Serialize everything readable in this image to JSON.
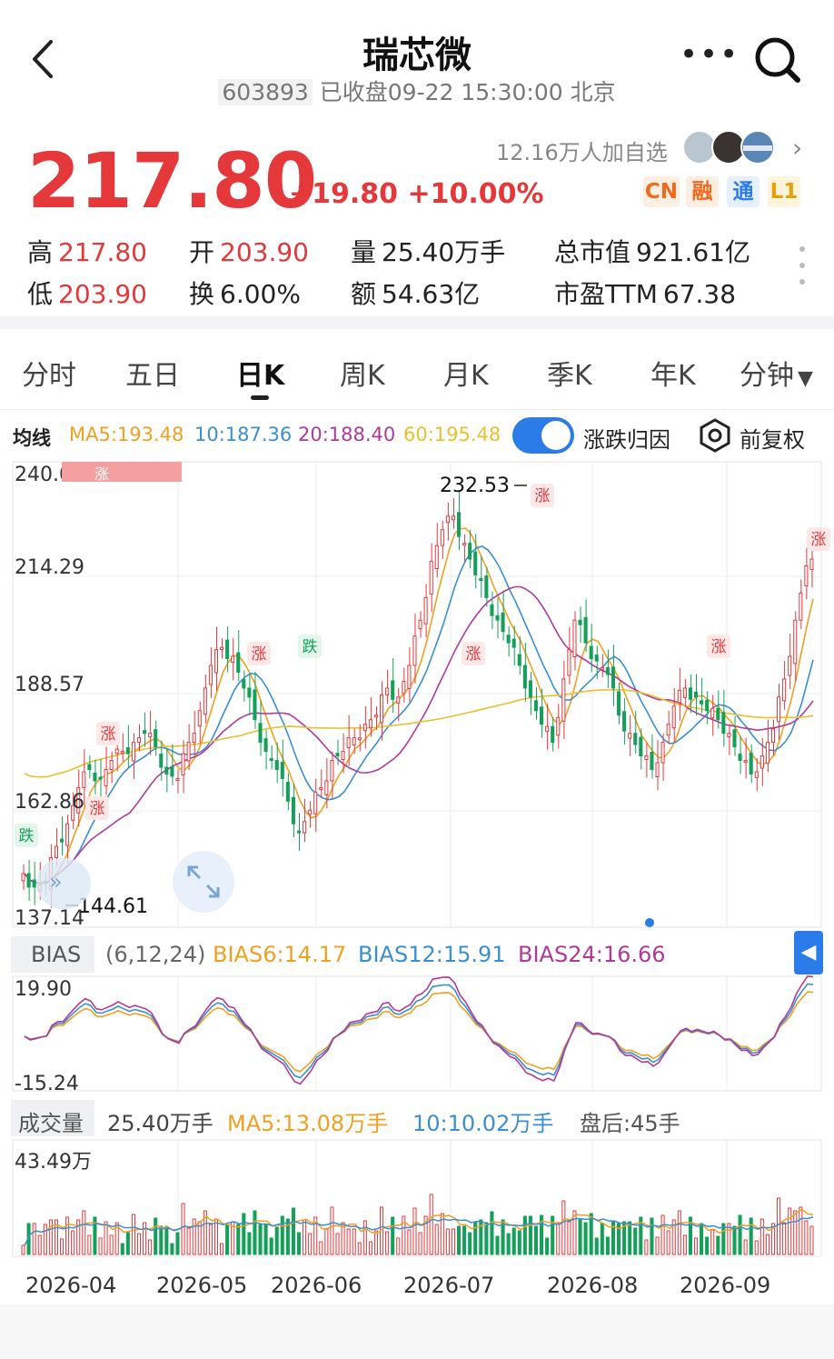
{
  "header": {
    "title": "瑞芯微",
    "code": "603893",
    "status": "已收盘09-22 15:30:00 北京"
  },
  "quote": {
    "price": "217.80",
    "change": "+19.80 +10.00%",
    "watchers": "12.16万人加自选",
    "badges": [
      "CN",
      "融",
      "通",
      "L1"
    ],
    "stats": {
      "high_label": "高",
      "high": "217.80",
      "open_label": "开",
      "open": "203.90",
      "volume_label": "量",
      "volume": "25.40万手",
      "mktcap_label": "总市值",
      "mktcap": "921.61亿",
      "low_label": "低",
      "low": "203.90",
      "turnover_label": "换",
      "turnover": "6.00%",
      "amount_label": "额",
      "amount": "54.63亿",
      "pe_label": "市盈TTM",
      "pe": "67.38"
    }
  },
  "tabs": [
    "分时",
    "五日",
    "日K",
    "周K",
    "月K",
    "季K",
    "年K",
    "分钟"
  ],
  "active_tab": "日K",
  "ma_bar": {
    "label": "均线",
    "ma5": "MA5:193.48",
    "ma10": "10:187.36",
    "ma20": "20:188.40",
    "ma60": "60:195.48",
    "attribution": "涨跌归因",
    "adjust": "前复权",
    "toggle_on": true
  },
  "colors": {
    "up": "#e5383b",
    "down": "#15a05a",
    "ma5": "#f0a020",
    "ma10": "#3a8fd0",
    "ma20": "#b03a9a",
    "ma60": "#e8c030",
    "accent": "#2b7ce9"
  },
  "bias": {
    "label": "BIAS",
    "params": "(6,12,24)",
    "b6": "BIAS6:14.17",
    "b12": "BIAS12:15.91",
    "b24": "BIAS24:16.66",
    "axis_top": "19.90",
    "axis_bottom": "-15.24"
  },
  "volume": {
    "label": "成交量",
    "value": "25.40万手",
    "ma5": "MA5:13.08万手",
    "ma10": "10:10.02万手",
    "after_hours": "盘后:45手",
    "axis_top": "43.49万"
  },
  "chart_data": {
    "type": "candlestick",
    "y_ticks": [
      "240.01",
      "214.29",
      "188.57",
      "162.86",
      "137.14"
    ],
    "ylim": [
      137.14,
      240.01
    ],
    "x_labels": [
      "2026-04",
      "2026-05",
      "2026-06",
      "2026-07",
      "2026-08",
      "2026-09"
    ],
    "annotations": {
      "high": "232.53",
      "low": "144.61",
      "up_marker": "涨",
      "down_marker": "跌"
    },
    "close_path": [
      149,
      146,
      147,
      155,
      160,
      168,
      172,
      170,
      174,
      176,
      178,
      180,
      177,
      171,
      170,
      178,
      185,
      195,
      199,
      197,
      190,
      183,
      176,
      172,
      165,
      158,
      163,
      168,
      174,
      176,
      179,
      182,
      184,
      190,
      188,
      195,
      205,
      218,
      225,
      228,
      222,
      215,
      210,
      205,
      200,
      195,
      188,
      182,
      178,
      192,
      205,
      200,
      196,
      193,
      184,
      180,
      175,
      172,
      178,
      186,
      190,
      188,
      185,
      183,
      180,
      174,
      171,
      175,
      181,
      192,
      205,
      217
    ]
  }
}
